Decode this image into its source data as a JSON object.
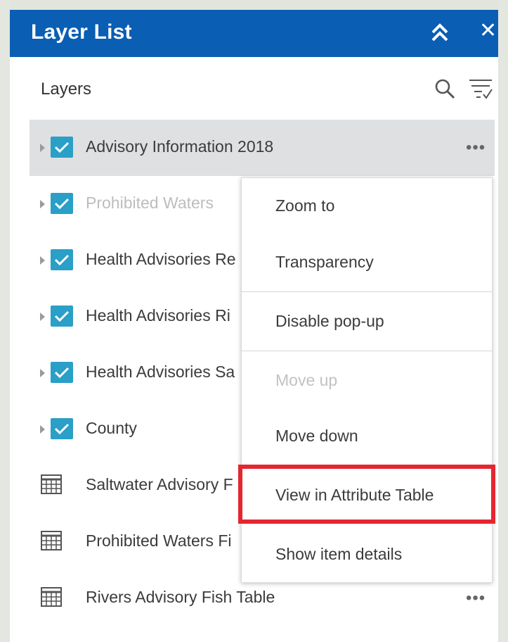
{
  "header": {
    "title": "Layer List",
    "collapse_icon": "double-chevron-up-icon",
    "close_label": "✕"
  },
  "toolbar": {
    "heading": "Layers",
    "search_icon": "search-icon",
    "filter_icon": "filter-list-icon"
  },
  "layers": [
    {
      "label": "Advisory Information 2018",
      "type": "layer",
      "checked": true,
      "selected": true
    },
    {
      "label": "Prohibited Waters",
      "type": "layer",
      "checked": true,
      "dimmed": true
    },
    {
      "label": "Health Advisories Re",
      "type": "layer",
      "checked": true
    },
    {
      "label": "Health Advisories Ri",
      "type": "layer",
      "checked": true
    },
    {
      "label": "Health Advisories Sa",
      "type": "layer",
      "checked": true
    },
    {
      "label": "County",
      "type": "layer",
      "checked": true
    },
    {
      "label": "Saltwater Advisory F",
      "type": "table"
    },
    {
      "label": "Prohibited Waters Fi",
      "type": "table"
    },
    {
      "label": "Rivers Advisory Fish Table",
      "type": "table"
    }
  ],
  "more_label": "•••",
  "context_menu": {
    "items": [
      {
        "label": "Zoom to",
        "enabled": true
      },
      {
        "label": "Transparency",
        "enabled": true
      },
      {
        "label": "Disable pop-up",
        "enabled": true
      },
      {
        "label": "Move up",
        "enabled": false
      },
      {
        "label": "Move down",
        "enabled": true
      },
      {
        "label": "View in Attribute Table",
        "enabled": true,
        "highlighted": true
      },
      {
        "label": "Show item details",
        "enabled": true
      }
    ]
  },
  "colors": {
    "header_bg": "#0a5eb3",
    "checkbox": "#2a9fc7",
    "highlight_box": "#e5262f",
    "selected_row": "#dfe0e2"
  }
}
